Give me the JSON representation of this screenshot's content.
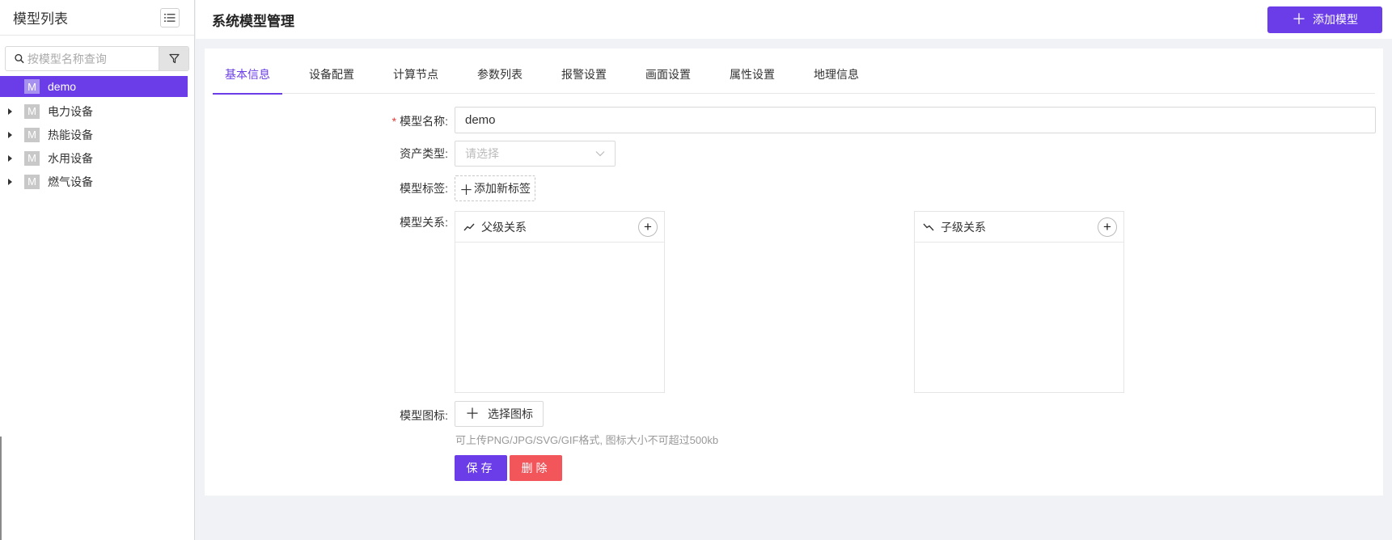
{
  "sidebar": {
    "title": "模型列表",
    "search_placeholder": "按模型名称查询",
    "items": [
      {
        "badge": "M",
        "label": "demo",
        "active": true,
        "has_children": false
      },
      {
        "badge": "M",
        "label": "电力设备",
        "active": false,
        "has_children": true
      },
      {
        "badge": "M",
        "label": "热能设备",
        "active": false,
        "has_children": true
      },
      {
        "badge": "M",
        "label": "水用设备",
        "active": false,
        "has_children": true
      },
      {
        "badge": "M",
        "label": "燃气设备",
        "active": false,
        "has_children": true
      }
    ]
  },
  "header": {
    "title": "系统模型管理",
    "add_button_label": "添加模型"
  },
  "tabs": [
    "基本信息",
    "设备配置",
    "计算节点",
    "参数列表",
    "报警设置",
    "画面设置",
    "属性设置",
    "地理信息"
  ],
  "active_tab": 0,
  "form": {
    "name_label": "模型名称:",
    "name_value": "demo",
    "asset_type_label": "资产类型:",
    "asset_type_placeholder": "请选择",
    "tags_label": "模型标签:",
    "add_tag_label": "添加新标签",
    "relation_label": "模型关系:",
    "parent_relation_title": "父级关系",
    "child_relation_title": "子级关系",
    "icon_label": "模型图标:",
    "choose_icon_label": "选择图标",
    "icon_hint": "可上传PNG/JPG/SVG/GIF格式, 图标大小不可超过500kb",
    "save_label": "保存",
    "delete_label": "删除"
  },
  "colors": {
    "accent": "#6a3de8",
    "danger": "#f2555a",
    "required": "#e53935"
  }
}
